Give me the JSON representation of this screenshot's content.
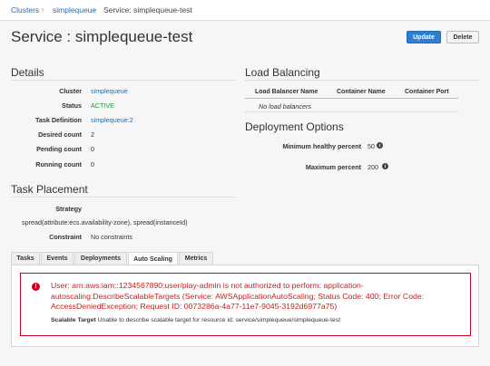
{
  "breadcrumb": {
    "clusters": "Clusters",
    "cluster": "simplequeue",
    "current": "Service: simplequeue-test",
    "sep": "›"
  },
  "page": {
    "title": "Service : simplequeue-test",
    "update_label": "Update",
    "delete_label": "Delete"
  },
  "details": {
    "title": "Details",
    "rows": [
      {
        "label": "Cluster",
        "value": "simplequeue"
      },
      {
        "label": "Status",
        "value": "ACTIVE"
      },
      {
        "label": "Task Definition",
        "value": "simplequeue:2"
      },
      {
        "label": "Desired count",
        "value": "2"
      },
      {
        "label": "Pending count",
        "value": "0"
      },
      {
        "label": "Running count",
        "value": "0"
      }
    ]
  },
  "load_balancing": {
    "title": "Load Balancing",
    "columns": [
      "Load Balancer Name",
      "Container Name",
      "Container Port"
    ],
    "empty": "No load balancers"
  },
  "deployment": {
    "title": "Deployment Options",
    "rows": [
      {
        "label": "Minimum healthy percent",
        "value": "50"
      },
      {
        "label": "Maximum percent",
        "value": "200"
      }
    ]
  },
  "placement": {
    "title": "Task Placement",
    "strategy_label": "Strategy",
    "strategy_value": "spread(attribute:ecs.availability-zone), spread(instanceId)",
    "constraint_label": "Constraint",
    "constraint_value": "No constraints"
  },
  "tabs": [
    "Tasks",
    "Events",
    "Deployments",
    "Auto Scaling",
    "Metrics"
  ],
  "active_tab": "Auto Scaling",
  "alert": {
    "icon": "!",
    "message": "User: arn:aws:iam::1234567890:user/play-admin is not authorized to perform: application-autoscaling:DescribeScalableTargets (Service: AWSApplicationAutoScaling; Status Code: 400; Error Code: AccessDeniedException; Request ID: 0073286a-4a77-11e7-9045-3192d6977a75)",
    "detail_label": "Scalable Target",
    "detail_text": "Unable to describe scalable target for resource id: service/simplequeue/simplequeue-test"
  },
  "colors": {
    "link": "#1f6bb5",
    "primary": "#2e7ed4",
    "active": "#2a9a3a",
    "error": "#d0021b"
  }
}
